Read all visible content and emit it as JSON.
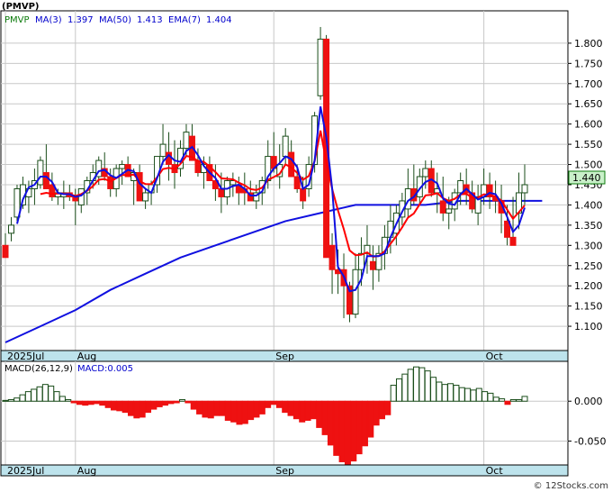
{
  "chart_data": [
    {
      "type": "candlestick",
      "title": "(PMVP)",
      "legend": {
        "symbol": "PMVP",
        "items": [
          {
            "label": "MA(3)",
            "value": "1.397",
            "color": "#0000cc"
          },
          {
            "label": "MA(50)",
            "value": "1.413",
            "color": "#0000cc"
          },
          {
            "label": "EMA(7)",
            "value": "1.404",
            "color": "#0000cc"
          }
        ]
      },
      "last_price_label": "1.440",
      "ylim": [
        1.04,
        1.88
      ],
      "y_ticks": [
        "1.800",
        "1.750",
        "1.700",
        "1.650",
        "1.600",
        "1.550",
        "1.500",
        "1.450",
        "1.400",
        "1.350",
        "1.300",
        "1.250",
        "1.200",
        "1.150",
        "1.100"
      ],
      "x_labels": [
        {
          "index": 0,
          "label": "2025Jul"
        },
        {
          "index": 12,
          "label": "Aug"
        },
        {
          "index": 46,
          "label": "Sep"
        },
        {
          "index": 82,
          "label": "Oct"
        }
      ],
      "candles": [
        [
          1.3,
          1.33,
          1.27,
          1.27
        ],
        [
          1.33,
          1.37,
          1.31,
          1.35
        ],
        [
          1.37,
          1.45,
          1.36,
          1.44
        ],
        [
          1.4,
          1.47,
          1.39,
          1.45
        ],
        [
          1.42,
          1.46,
          1.38,
          1.44
        ],
        [
          1.44,
          1.49,
          1.4,
          1.46
        ],
        [
          1.45,
          1.52,
          1.44,
          1.51
        ],
        [
          1.48,
          1.55,
          1.45,
          1.44
        ],
        [
          1.45,
          1.48,
          1.41,
          1.42
        ],
        [
          1.42,
          1.44,
          1.4,
          1.43
        ],
        [
          1.42,
          1.46,
          1.39,
          1.43
        ],
        [
          1.43,
          1.45,
          1.41,
          1.42
        ],
        [
          1.42,
          1.44,
          1.35,
          1.41
        ],
        [
          1.4,
          1.44,
          1.38,
          1.44
        ],
        [
          1.43,
          1.47,
          1.4,
          1.46
        ],
        [
          1.46,
          1.5,
          1.44,
          1.48
        ],
        [
          1.47,
          1.52,
          1.45,
          1.51
        ],
        [
          1.49,
          1.53,
          1.46,
          1.47
        ],
        [
          1.47,
          1.49,
          1.42,
          1.44
        ],
        [
          1.44,
          1.5,
          1.42,
          1.49
        ],
        [
          1.49,
          1.51,
          1.45,
          1.5
        ],
        [
          1.5,
          1.52,
          1.47,
          1.47
        ],
        [
          1.46,
          1.49,
          1.4,
          1.48
        ],
        [
          1.48,
          1.5,
          1.43,
          1.41
        ],
        [
          1.41,
          1.44,
          1.39,
          1.43
        ],
        [
          1.43,
          1.46,
          1.4,
          1.45
        ],
        [
          1.45,
          1.52,
          1.43,
          1.52
        ],
        [
          1.52,
          1.6,
          1.5,
          1.55
        ],
        [
          1.53,
          1.58,
          1.46,
          1.5
        ],
        [
          1.5,
          1.56,
          1.44,
          1.48
        ],
        [
          1.49,
          1.56,
          1.47,
          1.54
        ],
        [
          1.54,
          1.6,
          1.52,
          1.58
        ],
        [
          1.57,
          1.6,
          1.53,
          1.51
        ],
        [
          1.51,
          1.54,
          1.47,
          1.48
        ],
        [
          1.48,
          1.52,
          1.44,
          1.5
        ],
        [
          1.5,
          1.52,
          1.46,
          1.46
        ],
        [
          1.46,
          1.5,
          1.41,
          1.44
        ],
        [
          1.44,
          1.48,
          1.38,
          1.42
        ],
        [
          1.42,
          1.47,
          1.4,
          1.46
        ],
        [
          1.45,
          1.48,
          1.42,
          1.46
        ],
        [
          1.45,
          1.47,
          1.4,
          1.43
        ],
        [
          1.44,
          1.48,
          1.4,
          1.43
        ],
        [
          1.43,
          1.46,
          1.41,
          1.41
        ],
        [
          1.41,
          1.45,
          1.39,
          1.43
        ],
        [
          1.43,
          1.47,
          1.4,
          1.46
        ],
        [
          1.46,
          1.56,
          1.44,
          1.52
        ],
        [
          1.52,
          1.58,
          1.48,
          1.49
        ],
        [
          1.47,
          1.55,
          1.44,
          1.5
        ],
        [
          1.52,
          1.59,
          1.5,
          1.57
        ],
        [
          1.53,
          1.56,
          1.48,
          1.47
        ],
        [
          1.47,
          1.5,
          1.43,
          1.44
        ],
        [
          1.44,
          1.47,
          1.39,
          1.41
        ],
        [
          1.44,
          1.52,
          1.42,
          1.5
        ],
        [
          1.5,
          1.63,
          1.48,
          1.62
        ],
        [
          1.67,
          1.84,
          1.66,
          1.81
        ],
        [
          1.81,
          1.82,
          1.29,
          1.27
        ],
        [
          1.3,
          1.33,
          1.18,
          1.24
        ],
        [
          1.24,
          1.29,
          1.18,
          1.23
        ],
        [
          1.24,
          1.28,
          1.12,
          1.2
        ],
        [
          1.2,
          1.21,
          1.11,
          1.13
        ],
        [
          1.13,
          1.28,
          1.12,
          1.24
        ],
        [
          1.24,
          1.32,
          1.2,
          1.28
        ],
        [
          1.28,
          1.35,
          1.23,
          1.3
        ],
        [
          1.26,
          1.3,
          1.19,
          1.24
        ],
        [
          1.24,
          1.3,
          1.21,
          1.28
        ],
        [
          1.28,
          1.35,
          1.24,
          1.32
        ],
        [
          1.32,
          1.4,
          1.28,
          1.36
        ],
        [
          1.33,
          1.4,
          1.3,
          1.38
        ],
        [
          1.37,
          1.43,
          1.35,
          1.41
        ],
        [
          1.39,
          1.49,
          1.37,
          1.44
        ],
        [
          1.44,
          1.5,
          1.4,
          1.41
        ],
        [
          1.42,
          1.49,
          1.4,
          1.47
        ],
        [
          1.47,
          1.51,
          1.44,
          1.49
        ],
        [
          1.49,
          1.51,
          1.42,
          1.43
        ],
        [
          1.43,
          1.48,
          1.38,
          1.44
        ],
        [
          1.41,
          1.47,
          1.36,
          1.38
        ],
        [
          1.38,
          1.42,
          1.34,
          1.39
        ],
        [
          1.39,
          1.44,
          1.36,
          1.43
        ],
        [
          1.43,
          1.48,
          1.4,
          1.46
        ],
        [
          1.45,
          1.49,
          1.4,
          1.43
        ],
        [
          1.43,
          1.46,
          1.38,
          1.39
        ],
        [
          1.38,
          1.45,
          1.35,
          1.42
        ],
        [
          1.42,
          1.49,
          1.4,
          1.45
        ],
        [
          1.45,
          1.48,
          1.39,
          1.42
        ],
        [
          1.42,
          1.46,
          1.38,
          1.41
        ],
        [
          1.41,
          1.45,
          1.33,
          1.38
        ],
        [
          1.36,
          1.4,
          1.3,
          1.32
        ],
        [
          1.32,
          1.42,
          1.3,
          1.3
        ],
        [
          1.38,
          1.48,
          1.34,
          1.43
        ],
        [
          1.43,
          1.5,
          1.4,
          1.45
        ]
      ],
      "series": [
        {
          "name": "MA(3)",
          "color": "#1010e0"
        },
        {
          "name": "EMA(7)",
          "color": "#ff0000"
        },
        {
          "name": "MA(50)",
          "color": "#1010e0"
        }
      ],
      "ma50": [
        [
          0,
          1.06
        ],
        [
          6,
          1.1
        ],
        [
          12,
          1.14
        ],
        [
          18,
          1.19
        ],
        [
          24,
          1.23
        ],
        [
          30,
          1.27
        ],
        [
          36,
          1.3
        ],
        [
          42,
          1.33
        ],
        [
          48,
          1.36
        ],
        [
          54,
          1.38
        ],
        [
          60,
          1.4
        ],
        [
          66,
          1.4
        ],
        [
          72,
          1.4
        ],
        [
          78,
          1.41
        ],
        [
          84,
          1.41
        ],
        [
          90,
          1.41
        ],
        [
          92,
          1.41
        ]
      ]
    },
    {
      "type": "bar",
      "title": "MACD(26,12,9)",
      "legend_label": "MACD:0.005",
      "ylim": [
        -0.08,
        0.05
      ],
      "y_ticks": [
        "0.000",
        "-0.050"
      ],
      "x_labels": [
        {
          "index": 0,
          "label": "2025Jul"
        },
        {
          "index": 12,
          "label": "Aug"
        },
        {
          "index": 46,
          "label": "Sep"
        },
        {
          "index": 82,
          "label": "Oct"
        }
      ],
      "values": [
        0.001,
        0.002,
        0.004,
        0.008,
        0.012,
        0.015,
        0.018,
        0.021,
        0.019,
        0.012,
        0.006,
        0.002,
        -0.002,
        -0.004,
        -0.005,
        -0.004,
        -0.003,
        -0.005,
        -0.008,
        -0.011,
        -0.012,
        -0.014,
        -0.018,
        -0.021,
        -0.02,
        -0.014,
        -0.01,
        -0.007,
        -0.005,
        -0.003,
        -0.002,
        0.002,
        -0.002,
        -0.01,
        -0.016,
        -0.02,
        -0.021,
        -0.018,
        -0.018,
        -0.024,
        -0.026,
        -0.029,
        -0.028,
        -0.023,
        -0.02,
        -0.016,
        -0.008,
        -0.004,
        -0.008,
        -0.014,
        -0.018,
        -0.022,
        -0.026,
        -0.024,
        -0.022,
        -0.033,
        -0.042,
        -0.055,
        -0.068,
        -0.076,
        -0.08,
        -0.075,
        -0.066,
        -0.056,
        -0.045,
        -0.03,
        -0.022,
        -0.017,
        0.02,
        0.028,
        0.034,
        0.04,
        0.043,
        0.042,
        0.038,
        0.03,
        0.024,
        0.021,
        0.022,
        0.02,
        0.017,
        0.016,
        0.014,
        0.016,
        0.012,
        0.01,
        0.005,
        0.003,
        -0.004,
        0.002,
        0.002,
        0.006
      ]
    }
  ],
  "watermark": "© 12Stocks.com"
}
